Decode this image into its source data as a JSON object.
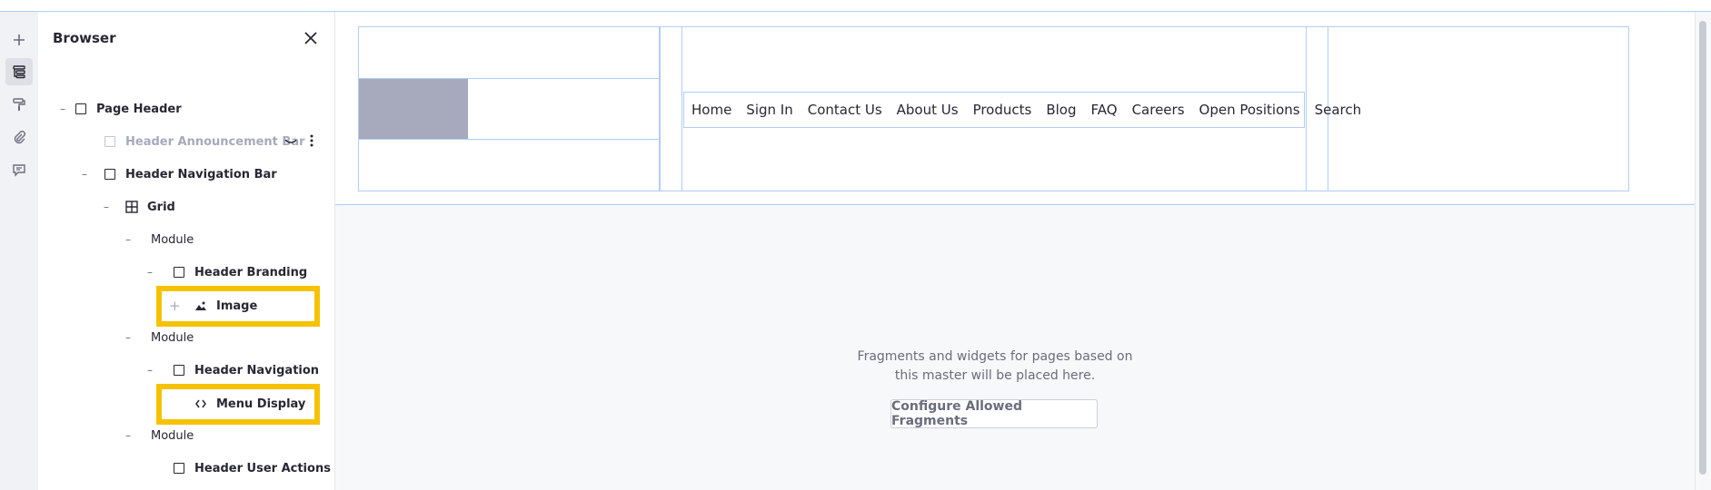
{
  "browser": {
    "title": "Browser",
    "tree": [
      {
        "label": "Page Header",
        "icon": "square-icon",
        "dash": "–"
      },
      {
        "label": "Header Announcement Bar",
        "icon": "square-icon",
        "hidden": true
      },
      {
        "label": "Header Navigation Bar",
        "icon": "square-icon",
        "dash": "–"
      },
      {
        "label": "Grid",
        "icon": "grid-icon",
        "dash": "–"
      },
      {
        "label": "Module",
        "dash": "–"
      },
      {
        "label": "Header Branding",
        "icon": "square-icon",
        "dash": "–"
      },
      {
        "label": "Image",
        "icon": "image-icon",
        "dash": "+"
      },
      {
        "label": "Module",
        "dash": "–"
      },
      {
        "label": "Header Navigation",
        "icon": "square-icon",
        "dash": "–"
      },
      {
        "label": "Menu Display",
        "icon": "code-icon"
      },
      {
        "label": "Module",
        "dash": "–"
      },
      {
        "label": "Header User Actions",
        "icon": "square-icon"
      }
    ]
  },
  "nav": {
    "items": [
      "Home",
      "Sign In",
      "Contact Us",
      "About Us",
      "Products",
      "Blog",
      "FAQ",
      "Careers",
      "Open Positions",
      "Search"
    ]
  },
  "dropzone": {
    "message_line1": "Fragments and widgets for pages based on",
    "message_line2": "this master will be placed here.",
    "configure_button": "Configure Allowed Fragments"
  },
  "colors": {
    "highlight": "#f6c200",
    "frame_border": "#b3cdf5",
    "image_placeholder": "#a7a9bc"
  }
}
